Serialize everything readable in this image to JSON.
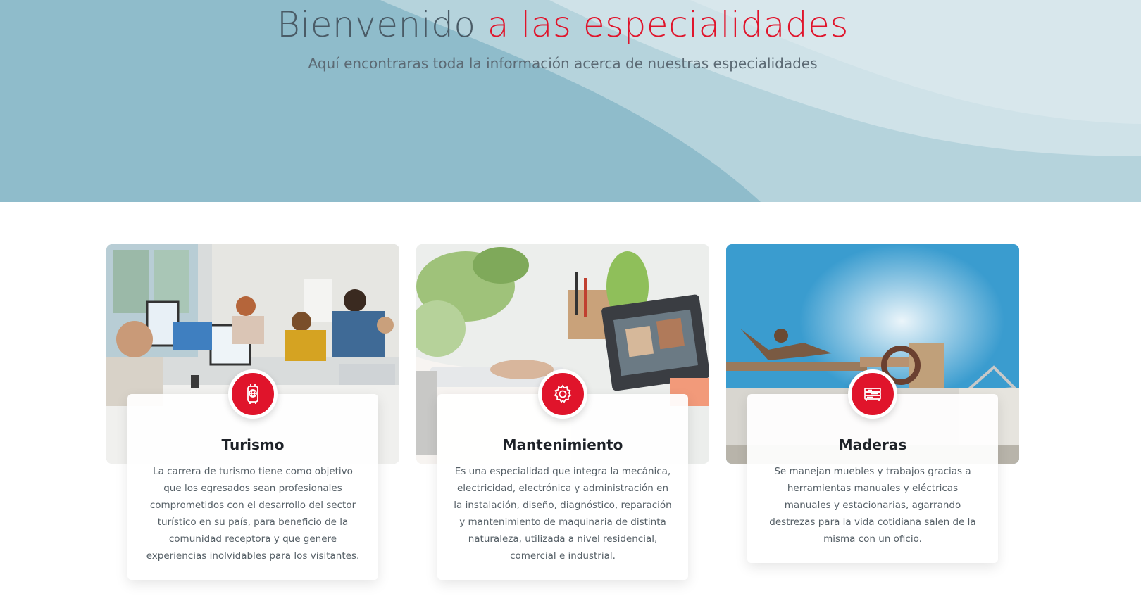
{
  "hero": {
    "title_part1": "Bienvenido",
    "title_part2": "a las especialidades",
    "subtitle": "Aquí encontraras toda la información acerca de nuestras especialidades"
  },
  "cards": [
    {
      "title": "Turismo",
      "icon": "globe-travel-icon",
      "description": "La carrera de turismo tiene como objetivo que los egresados sean profesionales comprometidos con el desarrollo del sector turístico en su país, para beneficio de la comunidad receptora y que genere experiencias inolvidables para los visitantes."
    },
    {
      "title": "Mantenimiento",
      "icon": "gear-icon",
      "description": "Es una especialidad que integra la mecánica, electricidad, electrónica y administración en la instalación, diseño, diagnóstico, reparación y mantenimiento de maquinaria de distinta naturaleza, utilizada a nivel residencial, comercial e industrial."
    },
    {
      "title": "Maderas",
      "icon": "wood-planks-icon",
      "description": "Se manejan muebles y trabajos gracias a herramientas manuales y eléctricas manuales y estacionarias, agarrando destrezas para la vida cotidiana salen de la misma con un oficio."
    }
  ],
  "colors": {
    "accent": "#e0142b",
    "hero_bg": "#8fbccb",
    "heading": "#4a5b66"
  }
}
